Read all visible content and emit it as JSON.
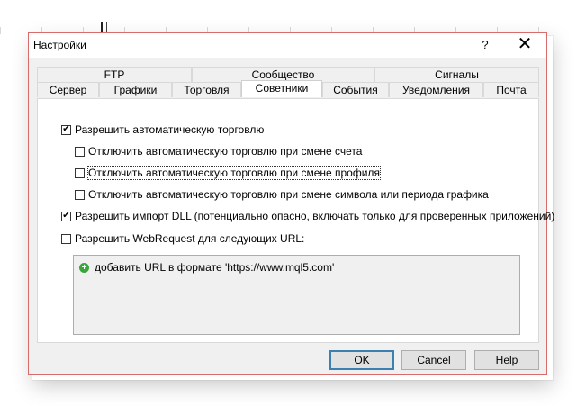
{
  "window": {
    "title": "Настройки",
    "help_label": "?",
    "close_label": "✕"
  },
  "tabs_top": [
    {
      "label": "FTP"
    },
    {
      "label": "Сообщество"
    },
    {
      "label": "Сигналы"
    }
  ],
  "tabs_bottom": [
    {
      "label": "Сервер"
    },
    {
      "label": "Графики"
    },
    {
      "label": "Торговля"
    },
    {
      "label": "Советники",
      "active": true
    },
    {
      "label": "События"
    },
    {
      "label": "Уведомления"
    },
    {
      "label": "Почта"
    }
  ],
  "options": {
    "allow_auto_trading": {
      "label": "Разрешить автоматическую торговлю",
      "checked": true
    },
    "disable_on_account_change": {
      "label": "Отключить автоматическую торговлю при смене счета",
      "checked": false
    },
    "disable_on_profile_change": {
      "label": "Отключить автоматическую торговлю при смене профиля",
      "checked": false
    },
    "disable_on_symbol_change": {
      "label": "Отключить автоматическую торговлю при смене символа или периода графика",
      "checked": false
    },
    "allow_dll_import": {
      "label": "Разрешить импорт DLL (потенциально опасно, включать только для проверенных приложений)",
      "checked": true
    },
    "allow_webrequest": {
      "label": "Разрешить WebRequest для следующих URL:",
      "checked": false
    }
  },
  "url_list": {
    "add_label": "добавить URL в формате 'https://www.mql5.com'",
    "add_icon": "plus-circle-icon"
  },
  "buttons": {
    "ok": "OK",
    "cancel": "Cancel",
    "help": "Help"
  },
  "colors": {
    "border_accent": "#d96b6b",
    "default_button_border": "#3c7fb1",
    "add_icon": "#3aa53a"
  }
}
